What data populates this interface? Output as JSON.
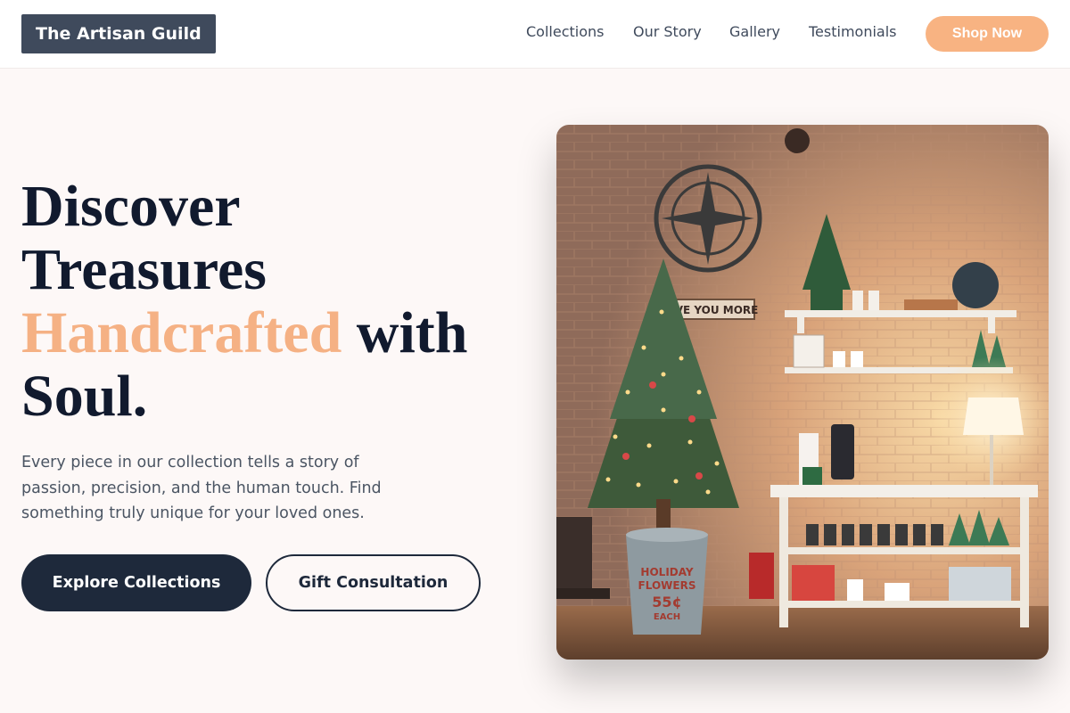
{
  "header": {
    "logo": "The Artisan Guild",
    "nav": [
      "Collections",
      "Our Story",
      "Gallery",
      "Testimonials"
    ],
    "cta": "Shop Now"
  },
  "hero": {
    "headline_line1": "Discover",
    "headline_line2": "Treasures",
    "headline_accent": "Handcrafted",
    "headline_with": "with",
    "headline_line4": "Soul.",
    "description": "Every piece in our collection tells a story of passion, precision, and the human touch. Find something truly unique for your loved ones.",
    "primary_button": "Explore Collections",
    "secondary_button": "Gift Consultation"
  },
  "image": {
    "wall_sign": "LOVE YOU MORE",
    "bucket_text_1": "HOLIDAY",
    "bucket_text_2": "FLOWERS",
    "bucket_text_3": "55¢",
    "bucket_text_4": "EACH"
  },
  "colors": {
    "accent": "#f5b184",
    "dark": "#1e293b",
    "logo_bg": "#3f4a5c",
    "page_bg": "#fdf8f7"
  }
}
